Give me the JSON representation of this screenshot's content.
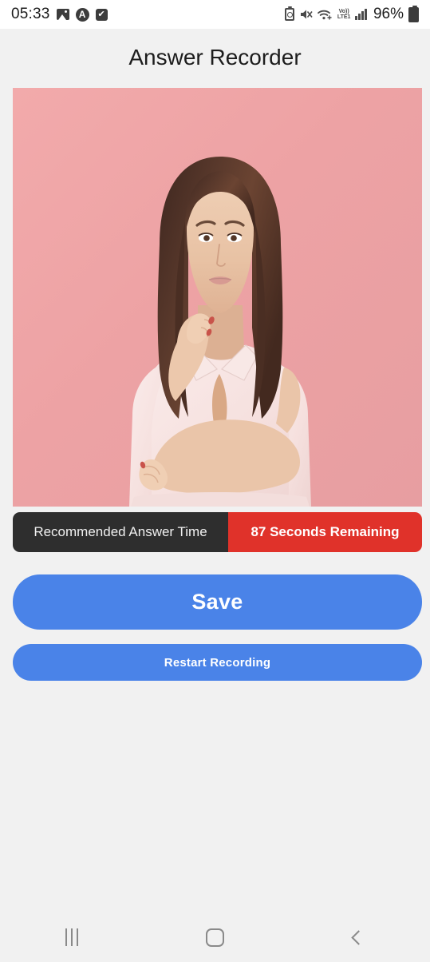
{
  "status_bar": {
    "time": "05:33",
    "battery_percent": "96%",
    "network_label": "VoLTE",
    "left_icons": [
      "gallery-icon",
      "circle-a-icon",
      "checkbox-icon"
    ],
    "right_icons": [
      "battery-saver-icon",
      "mute-icon",
      "wifi-icon",
      "volte-icon",
      "signal-icon",
      "battery-icon"
    ],
    "circle_a_letter": "A",
    "check_glyph": "✔",
    "volte_top": "Vo))",
    "volte_bottom": "LTE1"
  },
  "header": {
    "title": "Answer Recorder"
  },
  "media": {
    "alt": "woman-portrait-pink-background",
    "background_color": "#efa2a4",
    "skin_color": "#e9c3a8",
    "hair_color": "#4a3028",
    "top_color": "#f6e0de"
  },
  "info_bar": {
    "label": "Recommended Answer Time",
    "value": "87 Seconds Remaining",
    "label_bg": "#2e2e2e",
    "value_bg": "#e0322a"
  },
  "actions": {
    "save_label": "Save",
    "restart_label": "Restart Recording",
    "button_color": "#4a83e8"
  },
  "nav_bar": {
    "recents_label": "recents-icon",
    "home_label": "home-icon",
    "back_label": "back-icon"
  }
}
